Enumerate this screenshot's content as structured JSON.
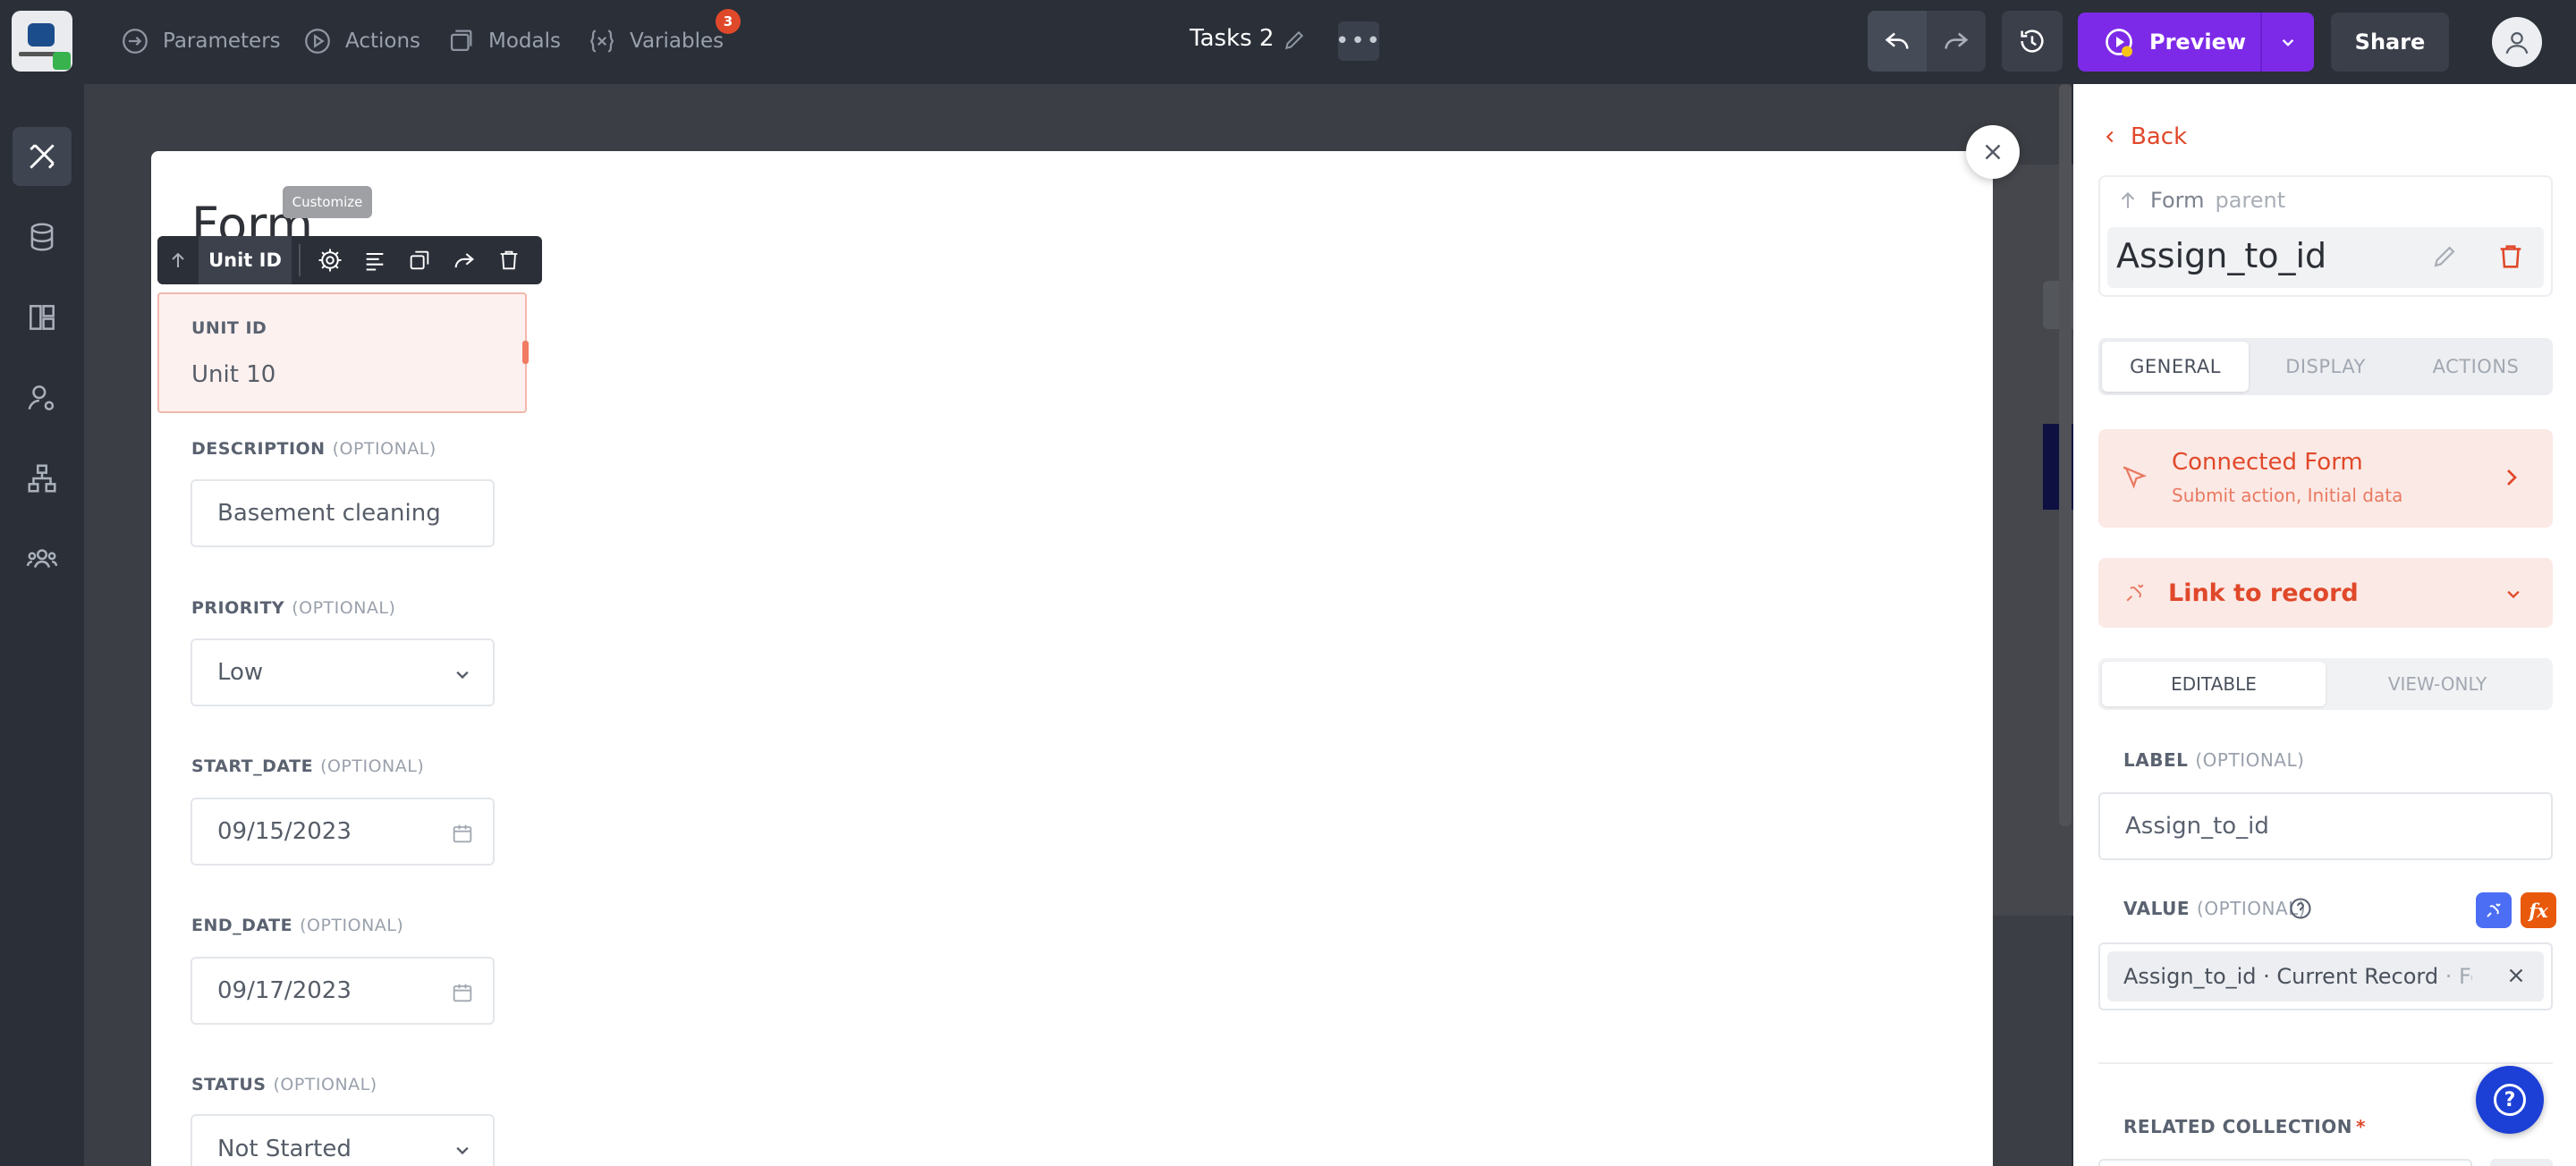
{
  "topbar": {
    "nav": [
      {
        "label": "Parameters",
        "icon": "parameters-icon"
      },
      {
        "label": "Actions",
        "icon": "actions-icon"
      },
      {
        "label": "Modals",
        "icon": "modals-icon"
      },
      {
        "label": "Variables",
        "icon": "variables-icon",
        "badge": "3"
      }
    ],
    "title": "Tasks 2",
    "preview_label": "Preview",
    "share_label": "Share"
  },
  "rail": {
    "items": [
      "design-icon",
      "database-icon",
      "layout-icon",
      "user-settings-icon",
      "hierarchy-icon",
      "users-icon"
    ]
  },
  "modal": {
    "title": "Form",
    "tooltip": "Customize",
    "toolbar_label": "Unit ID",
    "fields": [
      {
        "label": "UNIT ID",
        "optional": "",
        "value": "Unit 10",
        "type": "text"
      },
      {
        "label": "DESCRIPTION",
        "optional": "(OPTIONAL)",
        "value": "Basement cleaning",
        "type": "text"
      },
      {
        "label": "PRIORITY",
        "optional": "(OPTIONAL)",
        "value": "Low",
        "type": "select"
      },
      {
        "label": "START_DATE",
        "optional": "(OPTIONAL)",
        "value": "09/15/2023",
        "type": "date"
      },
      {
        "label": "END_DATE",
        "optional": "(OPTIONAL)",
        "value": "09/17/2023",
        "type": "date"
      },
      {
        "label": "STATUS",
        "optional": "(OPTIONAL)",
        "value": "Not Started",
        "type": "select"
      }
    ]
  },
  "panel": {
    "back_label": "Back",
    "parent_form": "Form",
    "parent_word": "parent",
    "element_name": "Assign_to_id",
    "tabs": [
      "GENERAL",
      "DISPLAY",
      "ACTIONS"
    ],
    "connected_form": {
      "title": "Connected Form",
      "subtitle": "Submit action, Initial data"
    },
    "link_to_record": "Link to record",
    "modes": [
      "EDITABLE",
      "VIEW-ONLY"
    ],
    "label_field": {
      "label": "LABEL",
      "optional": "(OPTIONAL)",
      "value": "Assign_to_id"
    },
    "value_field": {
      "label": "VALUE",
      "optional": "(OPTIONAL)",
      "value_main": "Assign_to_id · Current Record",
      "value_dim": " · For..."
    },
    "related_collection": {
      "label": "RELATED COLLECTION",
      "required": "*"
    },
    "fx_label": "fx"
  },
  "colors": {
    "accent": "#e0482a",
    "preview": "#7d2ae8",
    "bar": "#2a2f38"
  }
}
